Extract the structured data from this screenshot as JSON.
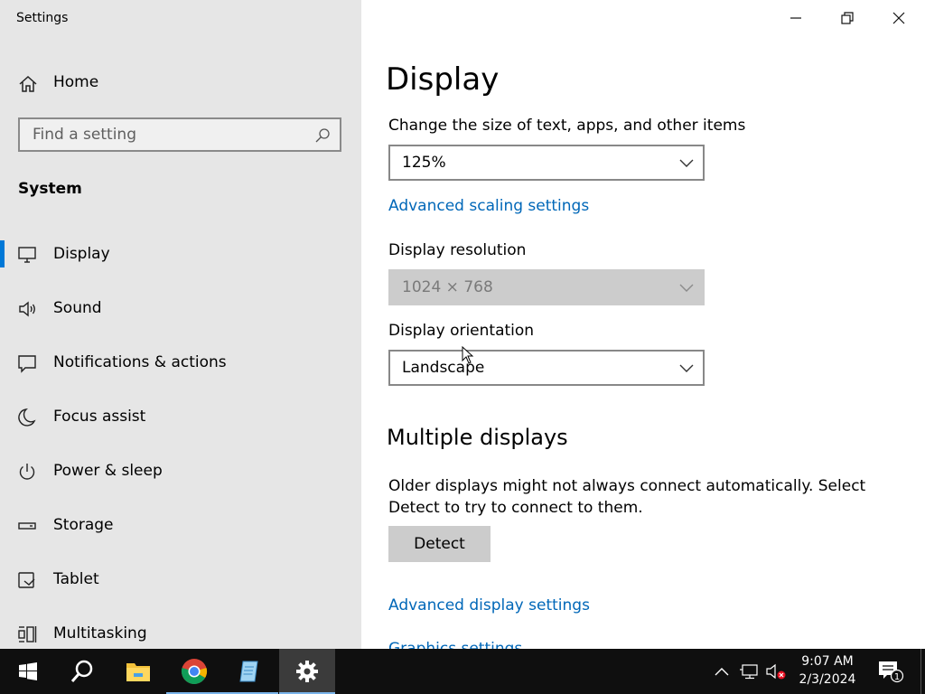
{
  "app": {
    "title": "Settings"
  },
  "sidebar": {
    "home_label": "Home",
    "search_placeholder": "Find a setting",
    "section_label": "System",
    "items": [
      {
        "label": "Display",
        "icon": "monitor-icon",
        "active": true
      },
      {
        "label": "Sound",
        "icon": "speaker-icon"
      },
      {
        "label": "Notifications & actions",
        "icon": "notification-icon"
      },
      {
        "label": "Focus assist",
        "icon": "moon-icon"
      },
      {
        "label": "Power & sleep",
        "icon": "power-icon"
      },
      {
        "label": "Storage",
        "icon": "storage-icon"
      },
      {
        "label": "Tablet",
        "icon": "tablet-icon"
      },
      {
        "label": "Multitasking",
        "icon": "multitasking-icon"
      }
    ]
  },
  "main": {
    "title": "Display",
    "scale": {
      "caption": "Change the size of text, apps, and other items",
      "value": "125%",
      "link": "Advanced scaling settings"
    },
    "resolution": {
      "caption": "Display resolution",
      "value": "1024 × 768"
    },
    "orientation": {
      "caption": "Display orientation",
      "value": "Landscape"
    },
    "multiple": {
      "title": "Multiple displays",
      "description": "Older displays might not always connect automatically. Select Detect to try to connect to them.",
      "detect_label": "Detect",
      "advanced_link": "Advanced display settings",
      "graphics_link": "Graphics settings"
    }
  },
  "taskbar": {
    "apps": [
      "start-icon",
      "search-icon",
      "file-explorer-icon",
      "chrome-icon",
      "notepad-icon",
      "settings-icon"
    ],
    "time": "9:07 AM",
    "date": "2/3/2024",
    "notification_count": "1"
  },
  "colors": {
    "accent": "#0078d7",
    "link": "#0067b8",
    "sidebar_bg": "#e6e6e6",
    "taskbar_bg": "#0f0f0f"
  }
}
